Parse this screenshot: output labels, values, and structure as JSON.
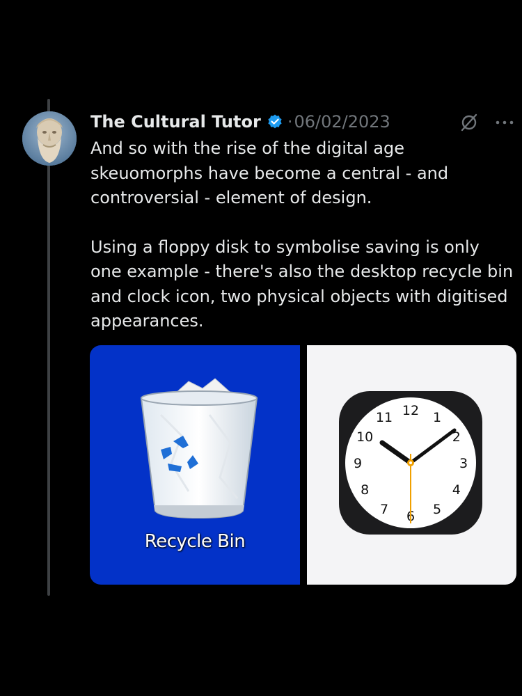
{
  "tweet": {
    "author_name": "The Cultural Tutor",
    "separator": "·",
    "date": "06/02/2023",
    "paragraphs": [
      "And so with the rise of the digital age skeuomorphs have become a central - and controversial - element of design.",
      "Using a floppy disk to symbolise saving is only one example - there's also the desktop recycle bin and clock icon, two physical objects with digitised appearances."
    ]
  },
  "icons": {
    "verified": "verified-badge-icon",
    "grok": "grok-icon",
    "more": "more-options-icon"
  },
  "media": {
    "left": {
      "label": "Recycle Bin"
    },
    "right": {
      "clock_numbers": [
        "12",
        "1",
        "2",
        "3",
        "4",
        "5",
        "6",
        "7",
        "8",
        "9",
        "10",
        "11"
      ]
    }
  },
  "colors": {
    "background": "#000000",
    "text": "#e7e9ea",
    "muted": "#71767b",
    "verified": "#1d9bf0",
    "windows_blue": "#0332c8",
    "clock_second_hand": "#f0a000"
  }
}
